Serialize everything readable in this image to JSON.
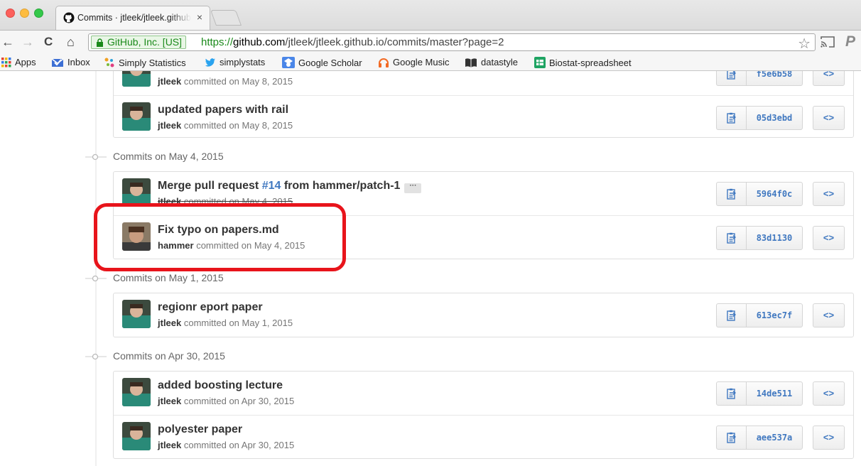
{
  "browser": {
    "tab_title": "Commits · jtleek/jtleek.github.io",
    "tab_close": "×",
    "ev_label": "GitHub, Inc. [US]",
    "url_scheme": "https://",
    "url_host": "github.com",
    "url_path": "/jtleek/jtleek.github.io/commits/master?page=2",
    "bookmarks": [
      {
        "label": "Apps"
      },
      {
        "label": "Inbox"
      },
      {
        "label": "Simply Statistics"
      },
      {
        "label": "simplystats"
      },
      {
        "label": "Google Scholar"
      },
      {
        "label": "Google Music"
      },
      {
        "label": "datastyle"
      },
      {
        "label": "Biostat-spreadsheet"
      }
    ]
  },
  "groups": [
    {
      "date_label": "",
      "commits": [
        {
          "message": "",
          "author": "jtleek",
          "when": "committed on May 8, 2015",
          "sha": "f5e6b58"
        },
        {
          "message": "updated papers with rail",
          "author": "jtleek",
          "when": "committed on May 8, 2015",
          "sha": "05d3ebd"
        }
      ]
    },
    {
      "date_label": "Commits on May 4, 2015",
      "commits": [
        {
          "message_prefix": "Merge pull request ",
          "message_link": "#14",
          "message_suffix": " from hammer/patch-1",
          "ellipsis": "···",
          "author": "jtleek",
          "when": "committed on May 4, 2015",
          "sha": "5964f0c"
        },
        {
          "message": "Fix typo on papers.md",
          "author": "hammer",
          "when": "committed on May 4, 2015",
          "sha": "83d1130"
        }
      ]
    },
    {
      "date_label": "Commits on May 1, 2015",
      "commits": [
        {
          "message": "regionr eport paper",
          "author": "jtleek",
          "when": "committed on May 1, 2015",
          "sha": "613ec7f"
        }
      ]
    },
    {
      "date_label": "Commits on Apr 30, 2015",
      "commits": [
        {
          "message": "added boosting lecture",
          "author": "jtleek",
          "when": "committed on Apr 30, 2015",
          "sha": "14de511"
        },
        {
          "message": "polyester paper",
          "author": "jtleek",
          "when": "committed on Apr 30, 2015",
          "sha": "aee537a"
        }
      ]
    }
  ],
  "browse_label": "<>",
  "colors": {
    "link": "#4078c0",
    "highlight": "#e8141b",
    "ev_green": "#1b8a1b"
  }
}
